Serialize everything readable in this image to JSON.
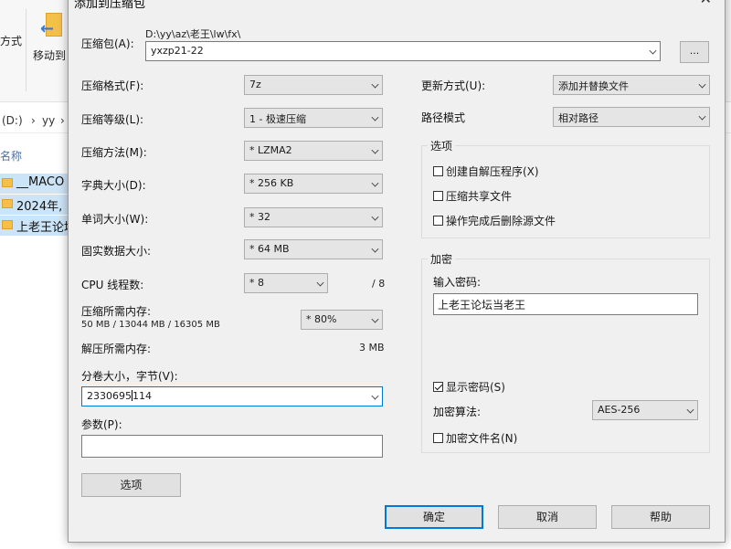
{
  "explorer": {
    "ribbon_left_label": "方式",
    "move_to_label": "移动到",
    "address": {
      "drive": "(D:)",
      "sep1": "›",
      "folder": "yy",
      "sep2": "›"
    },
    "name_column": "名称",
    "files": [
      "__MACO",
      "2024年,",
      "上老王论坛"
    ]
  },
  "dialog": {
    "title": "添加到压缩包",
    "close_glyph": "✕",
    "archive_label": "压缩包(A):",
    "archive_path": "D:\\yy\\az\\老王\\lw\\fx\\",
    "archive_name": "yxzp21-22",
    "browse_label": "...",
    "left": {
      "format_label": "压缩格式(F):",
      "format_value": "7z",
      "level_label": "压缩等级(L):",
      "level_value": "1 - 极速压缩",
      "method_label": "压缩方法(M):",
      "method_value": "* LZMA2",
      "dict_label": "字典大小(D):",
      "dict_value": "* 256 KB",
      "word_label": "单词大小(W):",
      "word_value": "* 32",
      "solid_label": "固实数据大小:",
      "solid_value": "* 64 MB",
      "threads_label": "CPU 线程数:",
      "threads_value": "* 8",
      "threads_total": "/ 8",
      "mem_comp_label": "压缩所需内存:",
      "mem_comp_values": "50 MB / 13044 MB / 16305 MB",
      "mem_comp_pct": "* 80%",
      "mem_decomp_label": "解压所需内存:",
      "mem_decomp_value": "3 MB",
      "split_label": "分卷大小，字节(V):",
      "split_value_a": "2330695",
      "split_value_b": "114",
      "params_label": "参数(P):",
      "params_value": "",
      "options_button": "选项"
    },
    "right": {
      "update_label": "更新方式(U):",
      "update_value": "添加并替换文件",
      "path_label": "路径模式",
      "path_value": "相对路径",
      "options_group": "选项",
      "opt_sfx": "创建自解压程序(X)",
      "opt_shared": "压缩共享文件",
      "opt_delete": "操作完成后删除源文件",
      "encrypt_group": "加密",
      "password_label": "输入密码:",
      "password_value": "上老王论坛当老王",
      "show_password": "显示密码(S)",
      "enc_method_label": "加密算法:",
      "enc_method_value": "AES-256",
      "encrypt_names": "加密文件名(N)"
    },
    "buttons": {
      "ok": "确定",
      "cancel": "取消",
      "help": "帮助"
    },
    "checks": {
      "sfx": false,
      "shared": false,
      "delete": false,
      "show_password": true,
      "encrypt_names": false
    }
  }
}
